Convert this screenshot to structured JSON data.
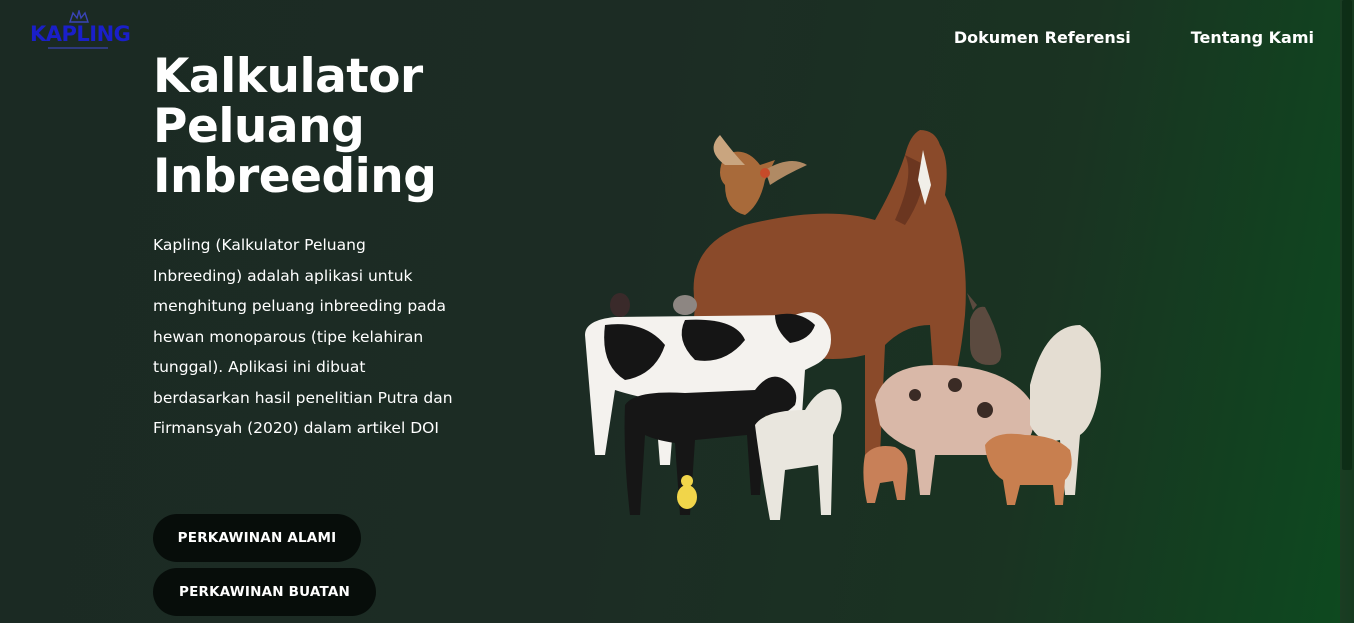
{
  "brand": {
    "logo_text": "KAPLING",
    "logo_color": "#1a1fc9"
  },
  "nav": {
    "items": [
      {
        "label": "Dokumen Referensi"
      },
      {
        "label": "Tentang Kami"
      }
    ]
  },
  "hero": {
    "title": "Kalkulator Peluang Inbreeding",
    "description": "Kapling (Kalkulator Peluang Inbreeding) adalah aplikasi untuk menghitung peluang inbreeding pada hewan monoparous (tipe kelahiran tunggal). Aplikasi ini dibuat berdasarkan hasil penelitian Putra dan Firmansyah (2020) dalam artikel DOI",
    "image_icon": "farm-animals-illustration"
  },
  "buttons": {
    "natural_label": "PERKAWINAN ALAMI",
    "artificial_label": "PERKAWINAN BUATAN"
  },
  "colors": {
    "background": "#1c2c24",
    "accent_green": "#0d4a1f",
    "button_bg": "#070d0a",
    "text": "#ffffff"
  }
}
